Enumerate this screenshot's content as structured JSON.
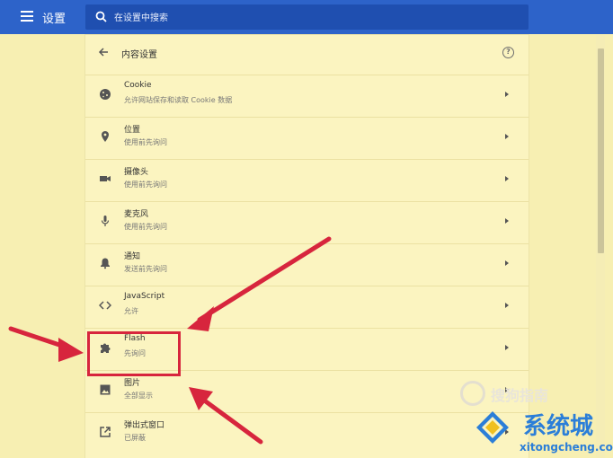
{
  "app": {
    "title": "设置"
  },
  "search": {
    "placeholder": "在设置中搜索"
  },
  "panel": {
    "title": "内容设置",
    "help_icon": "?"
  },
  "rows": [
    {
      "label": "Cookie",
      "sub": "允许网站保存和读取 Cookie 数据",
      "icon": "cookie-icon"
    },
    {
      "label": "位置",
      "sub": "使用前先询问",
      "icon": "location-icon"
    },
    {
      "label": "摄像头",
      "sub": "使用前先询问",
      "icon": "camera-icon"
    },
    {
      "label": "麦克风",
      "sub": "使用前先询问",
      "icon": "microphone-icon"
    },
    {
      "label": "通知",
      "sub": "发送前先询问",
      "icon": "bell-icon"
    },
    {
      "label": "JavaScript",
      "sub": "允许",
      "icon": "code-icon"
    },
    {
      "label": "Flash",
      "sub": "先询问",
      "icon": "puzzle-icon"
    },
    {
      "label": "图片",
      "sub": "全部显示",
      "icon": "image-icon"
    },
    {
      "label": "弹出式窗口",
      "sub": "已屏蔽",
      "icon": "open-in-new-icon"
    }
  ],
  "annotation_color": "#d7253d",
  "watermarks": {
    "sogou": "搜狗指南",
    "site_name": "系统城",
    "site_url": "xitongcheng.com"
  }
}
